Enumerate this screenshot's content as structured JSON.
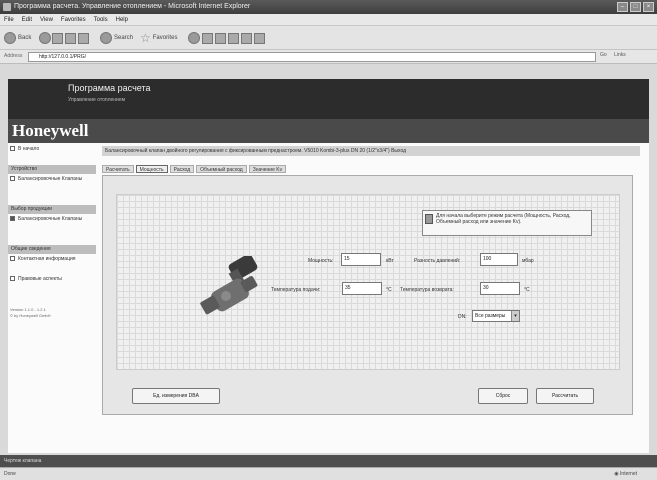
{
  "window": {
    "title": "Программа расчета. Управление отоплением - Microsoft Internet Explorer"
  },
  "menu": [
    "File",
    "Edit",
    "View",
    "Favorites",
    "Tools",
    "Help"
  ],
  "toolbar": {
    "back": "Back",
    "search": "Search",
    "favorites": "Favorites"
  },
  "address": {
    "label": "Address",
    "url": "http://127.0.0.1/PRG/",
    "go": "Go",
    "links": "Links"
  },
  "header": {
    "title": "Программа расчета",
    "subtitle": "Управление отоплением"
  },
  "brand": "Honeywell",
  "sidebar": {
    "home": "В начало",
    "section1": {
      "title": "Устройство",
      "item": "Балансировочные Клапаны"
    },
    "section2": {
      "title": "Выбор продукции",
      "item": "Балансировочные Клапаны"
    },
    "section3": {
      "title": "Общие сведения",
      "items": [
        "Контактная информация",
        "Правовые аспекты"
      ]
    },
    "version": "Version 1.1.0 - 1.2.1",
    "copyright": "© by Honeywell GmbH"
  },
  "infobar": "Балансировочный клапан двойного регулирования с фиксированным преднастроем. V5010 Kombi-3-plus DN 20 (1/2\"x3/4\")   Выход",
  "tabs": [
    "Расчитать",
    "Мощность",
    "Расход",
    "Объемный расход",
    "Значение Kv"
  ],
  "active_tab": 1,
  "hint": "Для начала выберите режим расчета (Мощность, Расход, Объемный расход или значение Kv).",
  "form": {
    "power": {
      "label": "Мощность:",
      "value": "15",
      "unit": "кВт"
    },
    "pressure_diff": {
      "label": "Разность давлений:",
      "value": "100",
      "unit": "мбар"
    },
    "supply_temp": {
      "label": "Температура подачи:",
      "value": "35",
      "unit": "°C"
    },
    "return_temp": {
      "label": "Температура возврата:",
      "value": "30",
      "unit": "°C"
    },
    "dn": {
      "label": "DN:",
      "value": "Все размеры"
    }
  },
  "buttons": {
    "units": "Ед. измерения DBA",
    "reset": "Сброс",
    "calculate": "Рассчитать"
  },
  "status_band": "Чертеж клапана",
  "ie_status": {
    "left": "Done",
    "zone": "Internet"
  }
}
